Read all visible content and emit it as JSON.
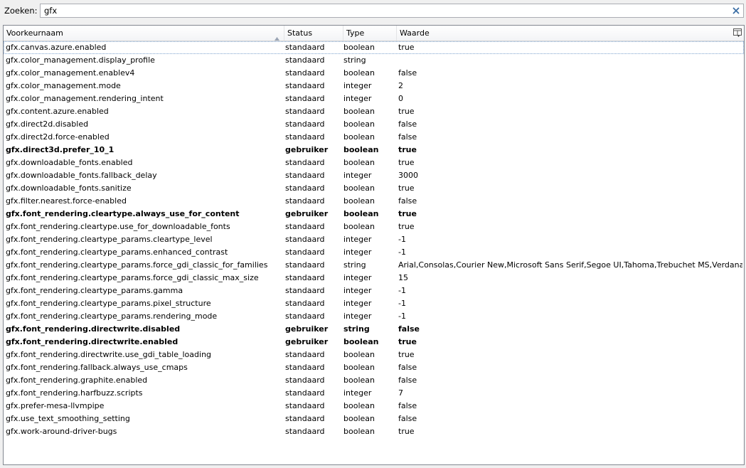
{
  "search": {
    "label": "Zoeken:",
    "value": "gfx"
  },
  "columns": {
    "name": "Voorkeurnaam",
    "status": "Status",
    "type": "Type",
    "value": "Waarde"
  },
  "rows": [
    {
      "name": "gfx.canvas.azure.enabled",
      "status": "standaard",
      "type": "boolean",
      "value": "true",
      "user": false
    },
    {
      "name": "gfx.color_management.display_profile",
      "status": "standaard",
      "type": "string",
      "value": "",
      "user": false
    },
    {
      "name": "gfx.color_management.enablev4",
      "status": "standaard",
      "type": "boolean",
      "value": "false",
      "user": false
    },
    {
      "name": "gfx.color_management.mode",
      "status": "standaard",
      "type": "integer",
      "value": "2",
      "user": false
    },
    {
      "name": "gfx.color_management.rendering_intent",
      "status": "standaard",
      "type": "integer",
      "value": "0",
      "user": false
    },
    {
      "name": "gfx.content.azure.enabled",
      "status": "standaard",
      "type": "boolean",
      "value": "true",
      "user": false
    },
    {
      "name": "gfx.direct2d.disabled",
      "status": "standaard",
      "type": "boolean",
      "value": "false",
      "user": false
    },
    {
      "name": "gfx.direct2d.force-enabled",
      "status": "standaard",
      "type": "boolean",
      "value": "false",
      "user": false
    },
    {
      "name": "gfx.direct3d.prefer_10_1",
      "status": "gebruiker",
      "type": "boolean",
      "value": "true",
      "user": true
    },
    {
      "name": "gfx.downloadable_fonts.enabled",
      "status": "standaard",
      "type": "boolean",
      "value": "true",
      "user": false
    },
    {
      "name": "gfx.downloadable_fonts.fallback_delay",
      "status": "standaard",
      "type": "integer",
      "value": "3000",
      "user": false
    },
    {
      "name": "gfx.downloadable_fonts.sanitize",
      "status": "standaard",
      "type": "boolean",
      "value": "true",
      "user": false
    },
    {
      "name": "gfx.filter.nearest.force-enabled",
      "status": "standaard",
      "type": "boolean",
      "value": "false",
      "user": false
    },
    {
      "name": "gfx.font_rendering.cleartype.always_use_for_content",
      "status": "gebruiker",
      "type": "boolean",
      "value": "true",
      "user": true
    },
    {
      "name": "gfx.font_rendering.cleartype.use_for_downloadable_fonts",
      "status": "standaard",
      "type": "boolean",
      "value": "true",
      "user": false
    },
    {
      "name": "gfx.font_rendering.cleartype_params.cleartype_level",
      "status": "standaard",
      "type": "integer",
      "value": "-1",
      "user": false
    },
    {
      "name": "gfx.font_rendering.cleartype_params.enhanced_contrast",
      "status": "standaard",
      "type": "integer",
      "value": "-1",
      "user": false
    },
    {
      "name": "gfx.font_rendering.cleartype_params.force_gdi_classic_for_families",
      "status": "standaard",
      "type": "string",
      "value": "Arial,Consolas,Courier New,Microsoft Sans Serif,Segoe UI,Tahoma,Trebuchet MS,Verdana",
      "user": false
    },
    {
      "name": "gfx.font_rendering.cleartype_params.force_gdi_classic_max_size",
      "status": "standaard",
      "type": "integer",
      "value": "15",
      "user": false
    },
    {
      "name": "gfx.font_rendering.cleartype_params.gamma",
      "status": "standaard",
      "type": "integer",
      "value": "-1",
      "user": false
    },
    {
      "name": "gfx.font_rendering.cleartype_params.pixel_structure",
      "status": "standaard",
      "type": "integer",
      "value": "-1",
      "user": false
    },
    {
      "name": "gfx.font_rendering.cleartype_params.rendering_mode",
      "status": "standaard",
      "type": "integer",
      "value": "-1",
      "user": false
    },
    {
      "name": "gfx.font_rendering.directwrite.disabled",
      "status": "gebruiker",
      "type": "string",
      "value": "false",
      "user": true
    },
    {
      "name": "gfx.font_rendering.directwrite.enabled",
      "status": "gebruiker",
      "type": "boolean",
      "value": "true",
      "user": true
    },
    {
      "name": "gfx.font_rendering.directwrite.use_gdi_table_loading",
      "status": "standaard",
      "type": "boolean",
      "value": "true",
      "user": false
    },
    {
      "name": "gfx.font_rendering.fallback.always_use_cmaps",
      "status": "standaard",
      "type": "boolean",
      "value": "false",
      "user": false
    },
    {
      "name": "gfx.font_rendering.graphite.enabled",
      "status": "standaard",
      "type": "boolean",
      "value": "false",
      "user": false
    },
    {
      "name": "gfx.font_rendering.harfbuzz.scripts",
      "status": "standaard",
      "type": "integer",
      "value": "7",
      "user": false
    },
    {
      "name": "gfx.prefer-mesa-llvmpipe",
      "status": "standaard",
      "type": "boolean",
      "value": "false",
      "user": false
    },
    {
      "name": "gfx.use_text_smoothing_setting",
      "status": "standaard",
      "type": "boolean",
      "value": "false",
      "user": false
    },
    {
      "name": "gfx.work-around-driver-bugs",
      "status": "standaard",
      "type": "boolean",
      "value": "true",
      "user": false
    }
  ]
}
